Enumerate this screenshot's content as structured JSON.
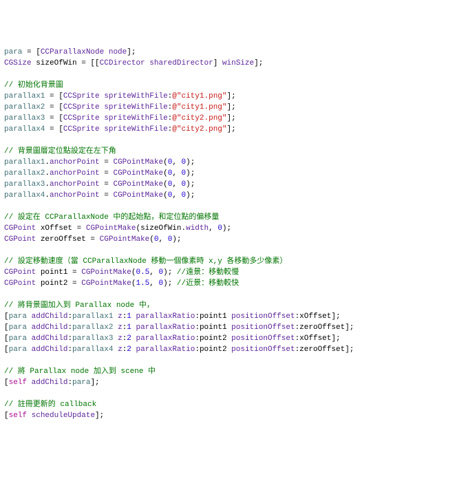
{
  "lines": [
    [
      {
        "cls": "tk-id",
        "t": "para"
      },
      {
        "cls": "tk-plain",
        "t": " = ["
      },
      {
        "cls": "tk-cls",
        "t": "CCParallaxNode"
      },
      {
        "cls": "tk-plain",
        "t": " "
      },
      {
        "cls": "tk-cls",
        "t": "node"
      },
      {
        "cls": "tk-plain",
        "t": "];"
      }
    ],
    [
      {
        "cls": "tk-cls",
        "t": "CGSize"
      },
      {
        "cls": "tk-plain",
        "t": " sizeOfWin = [["
      },
      {
        "cls": "tk-cls",
        "t": "CCDirector"
      },
      {
        "cls": "tk-plain",
        "t": " "
      },
      {
        "cls": "tk-cls",
        "t": "sharedDirector"
      },
      {
        "cls": "tk-plain",
        "t": "] "
      },
      {
        "cls": "tk-cls",
        "t": "winSize"
      },
      {
        "cls": "tk-plain",
        "t": "];"
      }
    ],
    [],
    [
      {
        "cls": "tk-cm",
        "t": "// 初始化背景圖"
      }
    ],
    [
      {
        "cls": "tk-id",
        "t": "parallax1"
      },
      {
        "cls": "tk-plain",
        "t": " = ["
      },
      {
        "cls": "tk-cls",
        "t": "CCSprite"
      },
      {
        "cls": "tk-plain",
        "t": " "
      },
      {
        "cls": "tk-cls",
        "t": "spriteWithFile"
      },
      {
        "cls": "tk-plain",
        "t": ":"
      },
      {
        "cls": "tk-str",
        "t": "@\"city1.png\""
      },
      {
        "cls": "tk-plain",
        "t": "];"
      }
    ],
    [
      {
        "cls": "tk-id",
        "t": "parallax2"
      },
      {
        "cls": "tk-plain",
        "t": " = ["
      },
      {
        "cls": "tk-cls",
        "t": "CCSprite"
      },
      {
        "cls": "tk-plain",
        "t": " "
      },
      {
        "cls": "tk-cls",
        "t": "spriteWithFile"
      },
      {
        "cls": "tk-plain",
        "t": ":"
      },
      {
        "cls": "tk-str",
        "t": "@\"city1.png\""
      },
      {
        "cls": "tk-plain",
        "t": "];"
      }
    ],
    [
      {
        "cls": "tk-id",
        "t": "parallax3"
      },
      {
        "cls": "tk-plain",
        "t": " = ["
      },
      {
        "cls": "tk-cls",
        "t": "CCSprite"
      },
      {
        "cls": "tk-plain",
        "t": " "
      },
      {
        "cls": "tk-cls",
        "t": "spriteWithFile"
      },
      {
        "cls": "tk-plain",
        "t": ":"
      },
      {
        "cls": "tk-str",
        "t": "@\"city2.png\""
      },
      {
        "cls": "tk-plain",
        "t": "];"
      }
    ],
    [
      {
        "cls": "tk-id",
        "t": "parallax4"
      },
      {
        "cls": "tk-plain",
        "t": " = ["
      },
      {
        "cls": "tk-cls",
        "t": "CCSprite"
      },
      {
        "cls": "tk-plain",
        "t": " "
      },
      {
        "cls": "tk-cls",
        "t": "spriteWithFile"
      },
      {
        "cls": "tk-plain",
        "t": ":"
      },
      {
        "cls": "tk-str",
        "t": "@\"city2.png\""
      },
      {
        "cls": "tk-plain",
        "t": "];"
      }
    ],
    [],
    [
      {
        "cls": "tk-cm",
        "t": "// 背景圖層定位點設定在左下角"
      }
    ],
    [
      {
        "cls": "tk-id",
        "t": "parallax1"
      },
      {
        "cls": "tk-plain",
        "t": "."
      },
      {
        "cls": "tk-cls",
        "t": "anchorPoint"
      },
      {
        "cls": "tk-plain",
        "t": " = "
      },
      {
        "cls": "tk-cls",
        "t": "CGPointMake"
      },
      {
        "cls": "tk-plain",
        "t": "("
      },
      {
        "cls": "tk-num",
        "t": "0"
      },
      {
        "cls": "tk-plain",
        "t": ", "
      },
      {
        "cls": "tk-num",
        "t": "0"
      },
      {
        "cls": "tk-plain",
        "t": ");"
      }
    ],
    [
      {
        "cls": "tk-id",
        "t": "parallax2"
      },
      {
        "cls": "tk-plain",
        "t": "."
      },
      {
        "cls": "tk-cls",
        "t": "anchorPoint"
      },
      {
        "cls": "tk-plain",
        "t": " = "
      },
      {
        "cls": "tk-cls",
        "t": "CGPointMake"
      },
      {
        "cls": "tk-plain",
        "t": "("
      },
      {
        "cls": "tk-num",
        "t": "0"
      },
      {
        "cls": "tk-plain",
        "t": ", "
      },
      {
        "cls": "tk-num",
        "t": "0"
      },
      {
        "cls": "tk-plain",
        "t": ");"
      }
    ],
    [
      {
        "cls": "tk-id",
        "t": "parallax3"
      },
      {
        "cls": "tk-plain",
        "t": "."
      },
      {
        "cls": "tk-cls",
        "t": "anchorPoint"
      },
      {
        "cls": "tk-plain",
        "t": " = "
      },
      {
        "cls": "tk-cls",
        "t": "CGPointMake"
      },
      {
        "cls": "tk-plain",
        "t": "("
      },
      {
        "cls": "tk-num",
        "t": "0"
      },
      {
        "cls": "tk-plain",
        "t": ", "
      },
      {
        "cls": "tk-num",
        "t": "0"
      },
      {
        "cls": "tk-plain",
        "t": ");"
      }
    ],
    [
      {
        "cls": "tk-id",
        "t": "parallax4"
      },
      {
        "cls": "tk-plain",
        "t": "."
      },
      {
        "cls": "tk-cls",
        "t": "anchorPoint"
      },
      {
        "cls": "tk-plain",
        "t": " = "
      },
      {
        "cls": "tk-cls",
        "t": "CGPointMake"
      },
      {
        "cls": "tk-plain",
        "t": "("
      },
      {
        "cls": "tk-num",
        "t": "0"
      },
      {
        "cls": "tk-plain",
        "t": ", "
      },
      {
        "cls": "tk-num",
        "t": "0"
      },
      {
        "cls": "tk-plain",
        "t": ");"
      }
    ],
    [],
    [
      {
        "cls": "tk-cm",
        "t": "// 設定在 CCParallaxNode 中的起始點，和定位點的偏移量"
      }
    ],
    [
      {
        "cls": "tk-cls",
        "t": "CGPoint"
      },
      {
        "cls": "tk-plain",
        "t": " xOffset = "
      },
      {
        "cls": "tk-cls",
        "t": "CGPointMake"
      },
      {
        "cls": "tk-plain",
        "t": "(sizeOfWin."
      },
      {
        "cls": "tk-cls",
        "t": "width"
      },
      {
        "cls": "tk-plain",
        "t": ", "
      },
      {
        "cls": "tk-num",
        "t": "0"
      },
      {
        "cls": "tk-plain",
        "t": ");"
      }
    ],
    [
      {
        "cls": "tk-cls",
        "t": "CGPoint"
      },
      {
        "cls": "tk-plain",
        "t": " zeroOffset = "
      },
      {
        "cls": "tk-cls",
        "t": "CGPointMake"
      },
      {
        "cls": "tk-plain",
        "t": "("
      },
      {
        "cls": "tk-num",
        "t": "0"
      },
      {
        "cls": "tk-plain",
        "t": ", "
      },
      {
        "cls": "tk-num",
        "t": "0"
      },
      {
        "cls": "tk-plain",
        "t": ");"
      }
    ],
    [],
    [
      {
        "cls": "tk-cm",
        "t": "// 設定移動速度（當 CCParallaxNode 移動一個像素時 x,y 各移動多少像素）"
      }
    ],
    [
      {
        "cls": "tk-cls",
        "t": "CGPoint"
      },
      {
        "cls": "tk-plain",
        "t": " point1 = "
      },
      {
        "cls": "tk-cls",
        "t": "CGPointMake"
      },
      {
        "cls": "tk-plain",
        "t": "("
      },
      {
        "cls": "tk-num",
        "t": "0.5"
      },
      {
        "cls": "tk-plain",
        "t": ", "
      },
      {
        "cls": "tk-num",
        "t": "0"
      },
      {
        "cls": "tk-plain",
        "t": "); "
      },
      {
        "cls": "tk-cm",
        "t": "//遠景：移動較慢"
      }
    ],
    [
      {
        "cls": "tk-cls",
        "t": "CGPoint"
      },
      {
        "cls": "tk-plain",
        "t": " point2 = "
      },
      {
        "cls": "tk-cls",
        "t": "CGPointMake"
      },
      {
        "cls": "tk-plain",
        "t": "("
      },
      {
        "cls": "tk-num",
        "t": "1.5"
      },
      {
        "cls": "tk-plain",
        "t": ", "
      },
      {
        "cls": "tk-num",
        "t": "0"
      },
      {
        "cls": "tk-plain",
        "t": "); "
      },
      {
        "cls": "tk-cm",
        "t": "//近景：移動較快"
      }
    ],
    [],
    [
      {
        "cls": "tk-cm",
        "t": "// 將背景圖加入到 Parallax node 中，"
      }
    ],
    [
      {
        "cls": "tk-plain",
        "t": "["
      },
      {
        "cls": "tk-id",
        "t": "para"
      },
      {
        "cls": "tk-plain",
        "t": " "
      },
      {
        "cls": "tk-cls",
        "t": "addChild"
      },
      {
        "cls": "tk-plain",
        "t": ":"
      },
      {
        "cls": "tk-id",
        "t": "parallax1"
      },
      {
        "cls": "tk-plain",
        "t": " "
      },
      {
        "cls": "tk-cls",
        "t": "z"
      },
      {
        "cls": "tk-plain",
        "t": ":"
      },
      {
        "cls": "tk-num",
        "t": "1"
      },
      {
        "cls": "tk-plain",
        "t": " "
      },
      {
        "cls": "tk-cls",
        "t": "parallaxRatio"
      },
      {
        "cls": "tk-plain",
        "t": ":point1 "
      },
      {
        "cls": "tk-cls",
        "t": "positionOffset"
      },
      {
        "cls": "tk-plain",
        "t": ":xOffset];"
      }
    ],
    [
      {
        "cls": "tk-plain",
        "t": "["
      },
      {
        "cls": "tk-id",
        "t": "para"
      },
      {
        "cls": "tk-plain",
        "t": " "
      },
      {
        "cls": "tk-cls",
        "t": "addChild"
      },
      {
        "cls": "tk-plain",
        "t": ":"
      },
      {
        "cls": "tk-id",
        "t": "parallax2"
      },
      {
        "cls": "tk-plain",
        "t": " "
      },
      {
        "cls": "tk-cls",
        "t": "z"
      },
      {
        "cls": "tk-plain",
        "t": ":"
      },
      {
        "cls": "tk-num",
        "t": "1"
      },
      {
        "cls": "tk-plain",
        "t": " "
      },
      {
        "cls": "tk-cls",
        "t": "parallaxRatio"
      },
      {
        "cls": "tk-plain",
        "t": ":point1 "
      },
      {
        "cls": "tk-cls",
        "t": "positionOffset"
      },
      {
        "cls": "tk-plain",
        "t": ":zeroOffset];"
      }
    ],
    [
      {
        "cls": "tk-plain",
        "t": "["
      },
      {
        "cls": "tk-id",
        "t": "para"
      },
      {
        "cls": "tk-plain",
        "t": " "
      },
      {
        "cls": "tk-cls",
        "t": "addChild"
      },
      {
        "cls": "tk-plain",
        "t": ":"
      },
      {
        "cls": "tk-id",
        "t": "parallax3"
      },
      {
        "cls": "tk-plain",
        "t": " "
      },
      {
        "cls": "tk-cls",
        "t": "z"
      },
      {
        "cls": "tk-plain",
        "t": ":"
      },
      {
        "cls": "tk-num",
        "t": "2"
      },
      {
        "cls": "tk-plain",
        "t": " "
      },
      {
        "cls": "tk-cls",
        "t": "parallaxRatio"
      },
      {
        "cls": "tk-plain",
        "t": ":point2 "
      },
      {
        "cls": "tk-cls",
        "t": "positionOffset"
      },
      {
        "cls": "tk-plain",
        "t": ":xOffset];"
      }
    ],
    [
      {
        "cls": "tk-plain",
        "t": "["
      },
      {
        "cls": "tk-id",
        "t": "para"
      },
      {
        "cls": "tk-plain",
        "t": " "
      },
      {
        "cls": "tk-cls",
        "t": "addChild"
      },
      {
        "cls": "tk-plain",
        "t": ":"
      },
      {
        "cls": "tk-id",
        "t": "parallax4"
      },
      {
        "cls": "tk-plain",
        "t": " "
      },
      {
        "cls": "tk-cls",
        "t": "z"
      },
      {
        "cls": "tk-plain",
        "t": ":"
      },
      {
        "cls": "tk-num",
        "t": "2"
      },
      {
        "cls": "tk-plain",
        "t": " "
      },
      {
        "cls": "tk-cls",
        "t": "parallaxRatio"
      },
      {
        "cls": "tk-plain",
        "t": ":point2 "
      },
      {
        "cls": "tk-cls",
        "t": "positionOffset"
      },
      {
        "cls": "tk-plain",
        "t": ":zeroOffset];"
      }
    ],
    [],
    [
      {
        "cls": "tk-cm",
        "t": "// 將 Parallax node 加入到 scene 中"
      }
    ],
    [
      {
        "cls": "tk-plain",
        "t": "["
      },
      {
        "cls": "tk-kw",
        "t": "self"
      },
      {
        "cls": "tk-plain",
        "t": " "
      },
      {
        "cls": "tk-cls",
        "t": "addChild"
      },
      {
        "cls": "tk-plain",
        "t": ":"
      },
      {
        "cls": "tk-id",
        "t": "para"
      },
      {
        "cls": "tk-plain",
        "t": "];"
      }
    ],
    [],
    [
      {
        "cls": "tk-cm",
        "t": "// 註冊更新的 callback"
      }
    ],
    [
      {
        "cls": "tk-plain",
        "t": "["
      },
      {
        "cls": "tk-kw",
        "t": "self"
      },
      {
        "cls": "tk-plain",
        "t": " "
      },
      {
        "cls": "tk-cls",
        "t": "scheduleUpdate"
      },
      {
        "cls": "tk-plain",
        "t": "];"
      }
    ]
  ]
}
